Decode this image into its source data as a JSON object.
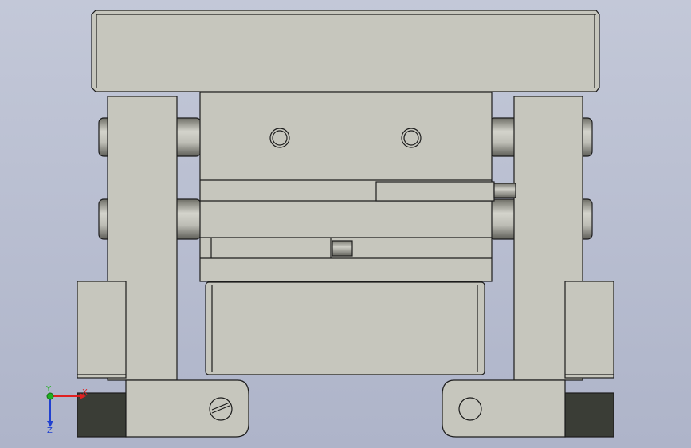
{
  "viewport": {
    "background_top": "#c3c8d8",
    "background_bottom": "#aeb4c9",
    "part_fill": "#c6c6bd",
    "edge_color": "#1c1c1c",
    "dark_fill": "#3a3d36"
  },
  "triad": {
    "x_label": "X",
    "y_label": "Y",
    "z_label": "Z",
    "x_color": "#e02020",
    "y_color": "#20b020",
    "z_color": "#2040d0"
  }
}
